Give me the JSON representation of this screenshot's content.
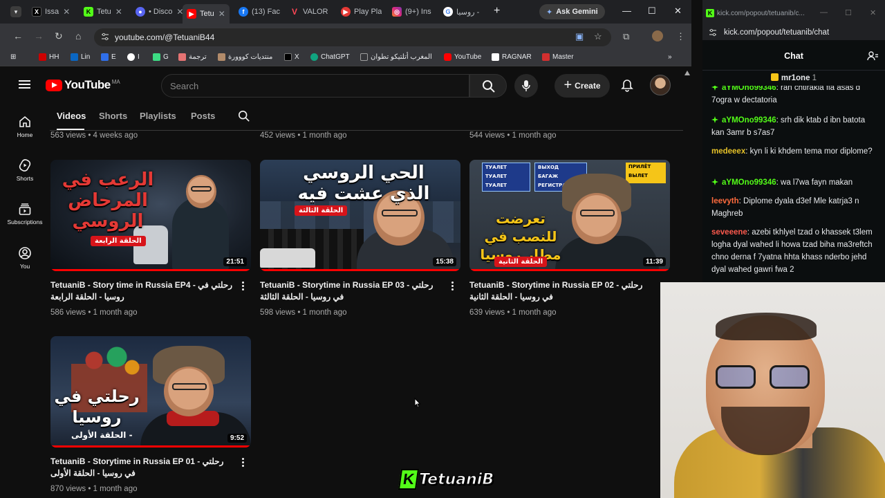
{
  "browser": {
    "tabs": [
      {
        "label": "Issa",
        "icon": "x-logo-icon",
        "color": "#000000"
      },
      {
        "label": "Tetu",
        "icon": "kick-logo-icon",
        "color": "#53fc18"
      },
      {
        "label": "• Disco",
        "icon": "discord-icon",
        "color": "#5865f2"
      },
      {
        "label": "Tetu",
        "icon": "youtube-icon",
        "color": "#ff0000"
      },
      {
        "label": "(13) Fac",
        "icon": "facebook-icon",
        "color": "#1877f2"
      },
      {
        "label": "VALOR",
        "icon": "valorant-icon",
        "color": "#ff4655"
      },
      {
        "label": "Play Pla",
        "icon": "play-icon",
        "color": "#e53935"
      },
      {
        "label": "(9+) Ins",
        "icon": "instagram-icon",
        "color": "#e1306c"
      },
      {
        "label": "روسيا -",
        "icon": "google-icon",
        "color": "#4285f4"
      }
    ],
    "gemini_label": "Ask Gemini",
    "url": "youtube.com/@TetuaniB44",
    "bookmarks": [
      {
        "label": "HH",
        "color": "#cc0000"
      },
      {
        "label": "Lin",
        "color": "#0a66c2"
      },
      {
        "label": "E",
        "color": "#2f6fea"
      },
      {
        "label": "I",
        "color": "#ffffff"
      },
      {
        "label": "G",
        "color": "#3ddc84"
      },
      {
        "label": "ترجمة",
        "color": "#e57373"
      },
      {
        "label": "منتديات كووورة",
        "color": "#b28b6a"
      },
      {
        "label": "X",
        "color": "#000000"
      },
      {
        "label": "ChatGPT",
        "color": "#10a37f"
      },
      {
        "label": "المغرب أتلتيكو تطوان",
        "color": "#9e9e9e"
      },
      {
        "label": "YouTube",
        "color": "#ff0000"
      },
      {
        "label": "RAGNAR",
        "color": "#ffffff"
      },
      {
        "label": "Master",
        "color": "#d32f2f"
      }
    ]
  },
  "youtube": {
    "logo_text": "YouTube",
    "country_code": "MA",
    "search_placeholder": "Search",
    "create_label": "Create",
    "sidebar": [
      {
        "label": "Home",
        "icon": "home-icon"
      },
      {
        "label": "Shorts",
        "icon": "shorts-icon"
      },
      {
        "label": "Subscriptions",
        "icon": "subscriptions-icon"
      },
      {
        "label": "You",
        "icon": "you-icon"
      }
    ],
    "channel_tabs": [
      "Videos",
      "Shorts",
      "Playlists",
      "Posts"
    ],
    "top_row_meta": [
      "563 views • 4 weeks ago",
      "452 views • 1 month ago",
      "544 views • 1 month ago"
    ],
    "videos": [
      {
        "title": "TetuaniB - Story time in Russia EP4 - رحلتي في روسيا - الحلقة الرابعة",
        "views": "586 views • 1 month ago",
        "duration": "21:51",
        "thumb_text": "الرعب في المرحاض الروسي",
        "thumb_badge": "الحلقة الرابعة"
      },
      {
        "title": "TetuaniB - Storytime in Russia EP 03 - رحلتي في روسيا - الحلقة الثالثة",
        "views": "598 views • 1 month ago",
        "duration": "15:38",
        "thumb_text": "الحي الروسي الذي عشت فيه",
        "thumb_badge": "الحلقة الثالثة"
      },
      {
        "title": "TetuaniB - Storytime in Russia EP 02 - رحلتي في روسيا - الحلقة الثانية",
        "views": "639 views • 1 month ago",
        "duration": "11:39",
        "thumb_text": "تعرضت للنصب في مطار روسيا",
        "thumb_badge": "الحلقة الثانية",
        "thumb_signs": [
          "ТУАЛЕТ",
          "ТУАЛЕТ",
          "ТУАЛЕТ",
          "ВЫХОД",
          "БАГАЖ",
          "РЕГИСТРАЦИЯ",
          "ПРИЛЁТ",
          "ВЫЛЕТ"
        ]
      },
      {
        "title": "TetuaniB - Storytime in Russia EP 01 - رحلتي في روسيا - الحلقة الأولى",
        "views": "870 views • 1 month ago",
        "duration": "9:52",
        "thumb_text": "رحلتي في روسيا",
        "thumb_badge": "- الحلقة الأولى"
      }
    ]
  },
  "watermark": "TetuaniB",
  "kick": {
    "window_title": "kick.com/popout/tetuanib/c...",
    "url": "kick.com/popout/tetuanib/chat",
    "chat_title": "Chat",
    "pinned_user": "mr1one",
    "pinned_count": "1",
    "messages": [
      {
        "user": "aYMOno99346",
        "text": "ran chtirakia fla asas d 7ogra w dectatoria",
        "user_color": "#53fc18",
        "gem": true
      },
      {
        "user": "aYMOno99346",
        "text": "srh dik ktab d ibn batota kan 3amr b s7as7",
        "user_color": "#53fc18",
        "gem": true
      },
      {
        "user": "medeeex",
        "text": "kyn li ki khdem tema mor diplome?",
        "user_color": "#e6c229",
        "gem": false
      },
      {
        "user": "aYMOno99346",
        "text": "wa l7wa fayn makan",
        "user_color": "#53fc18",
        "gem": true
      },
      {
        "user": "leevyth",
        "text": "Diplome dyala d3ef Mle katrja3 n Maghreb",
        "user_color": "#ff6b3d",
        "gem": false
      },
      {
        "user": "seveeene",
        "text": "azebi tkhlyel tzad o khassek t3lem logha dyal wahed li howa tzad biha ma3reftch chno derna f 7yatna hhta khass nderbo jehd dyal wahed gawri fwa 2",
        "user_color": "#ff5a4e",
        "gem": false
      }
    ]
  }
}
